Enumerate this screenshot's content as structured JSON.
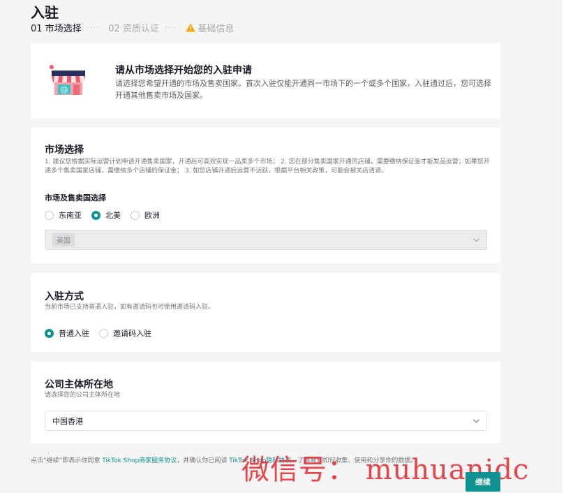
{
  "page": {
    "title": "入驻"
  },
  "steps": {
    "step1": "01 市场选择",
    "dots": "·····",
    "step2": "02 资质认证",
    "step3": "基础信息"
  },
  "intro": {
    "title": "请从市场选择开始您的入驻申请",
    "desc": "请选择您希望开通的市场及售卖国家。首次入驻仅能开通同一市场下的一个或多个国家，入驻通过后，您可选择开通其他售卖市场及国家。"
  },
  "market": {
    "title": "市场选择",
    "desc": "1. 建议您根据实际运营计划申请开通售卖国家，开通后可高效实现一品卖多个市场； 2. 您在部分售卖国家开通的店铺，需要缴纳保证金才能发品运营；如果您开通多个售卖国家店铺，需缴纳多个店铺的保证金； 3. 如您店铺开通后运营不活跃，根据平台相关政策，可能会被关店清退。",
    "sub_label": "市场及售卖国选择",
    "options": [
      "东南亚",
      "北美",
      "欧洲"
    ],
    "selected": "北美",
    "country_tag": "美国"
  },
  "method": {
    "title": "入驻方式",
    "desc": "当前市场已支持普通入驻，如有邀请码也可使用邀请码入驻。",
    "options": [
      "普通入驻",
      "邀请码入驻"
    ],
    "selected": "普通入驻"
  },
  "company": {
    "title": "公司主体所在地",
    "desc": "请选择您的公司主体所在地",
    "value": "中国香港"
  },
  "footer": {
    "prefix": "点击“继续”即表示你同意 ",
    "link1": "TikTok Shop商家服务协议",
    "middle": "，并确认你已阅读 ",
    "link2": "TikTok Shop隐私协议",
    "suffix": "，了解我们如何收集、使用和分享你的数据。"
  },
  "actions": {
    "continue_label": "继续"
  },
  "watermark": {
    "text": "微信号： muhuanidc"
  },
  "colors": {
    "accent": "#0d9191",
    "warning": "#ff9f00",
    "watermark": "#e8333a"
  }
}
